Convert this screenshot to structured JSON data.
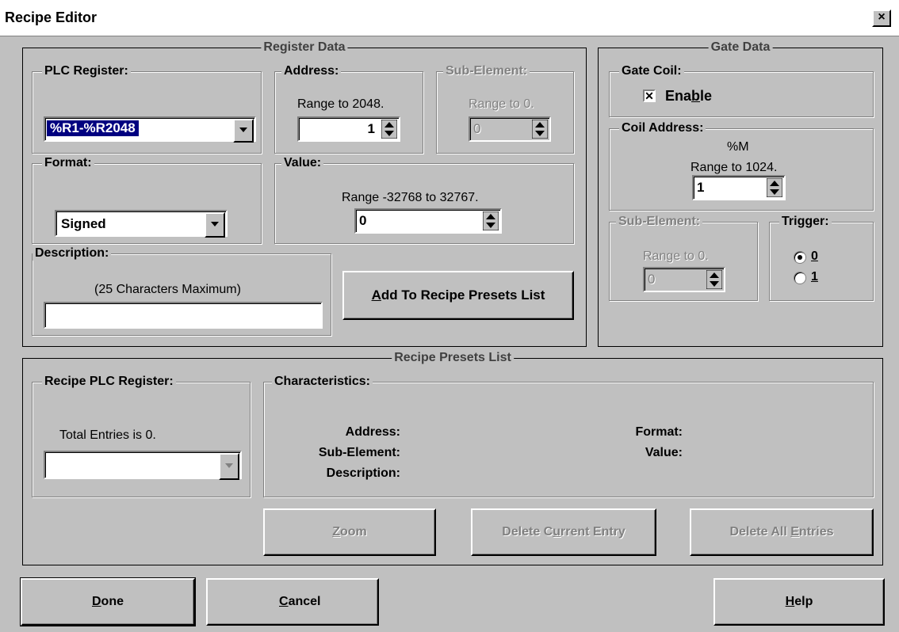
{
  "window": {
    "title": "Recipe Editor",
    "close_glyph": "×"
  },
  "register_data": {
    "title": "Register Data",
    "plc_register": {
      "label": "PLC Register:",
      "value": "%R1-%R2048"
    },
    "address": {
      "label": "Address:",
      "range": "Range to 2048.",
      "value": "1"
    },
    "sub_element": {
      "label": "Sub-Element:",
      "range": "Range to 0.",
      "value": "0"
    },
    "format": {
      "label": "Format:",
      "value": "Signed"
    },
    "value": {
      "label": "Value:",
      "range": "Range -32768 to 32767.",
      "value": "0"
    },
    "description": {
      "label": "Description:",
      "hint": "(25 Characters Maximum)",
      "value": ""
    },
    "add_button": {
      "accel": "A",
      "rest": "dd To Recipe Presets List"
    }
  },
  "gate_data": {
    "title": "Gate Data",
    "gate_coil": {
      "label": "Gate Coil:",
      "enable_pre": "Ena",
      "enable_accel": "b",
      "enable_post": "le",
      "checked": true
    },
    "coil_address": {
      "label": "Coil Address:",
      "prefix": "%M",
      "range": "Range to 1024.",
      "value": "1"
    },
    "sub_element": {
      "label": "Sub-Element:",
      "range": "Range to 0.",
      "value": "0"
    },
    "trigger": {
      "label": "Trigger:",
      "options": [
        "0",
        "1"
      ],
      "selected": "0"
    }
  },
  "recipe_presets": {
    "title": "Recipe Presets List",
    "recipe_plc_register": {
      "label": "Recipe PLC Register:",
      "total": "Total Entries is 0.",
      "value": ""
    },
    "characteristics": {
      "label": "Characteristics:",
      "address_label": "Address:",
      "sub_element_label": "Sub-Element:",
      "description_label": "Description:",
      "format_label": "Format:",
      "value_label": "Value:"
    },
    "zoom_button": {
      "accel": "Z",
      "rest": "oom"
    },
    "delete_current_button": {
      "pre": "Delete C",
      "accel": "u",
      "post": "rrent Entry"
    },
    "delete_all_button": {
      "pre": "Delete All ",
      "accel": "E",
      "post": "ntries"
    }
  },
  "footer": {
    "done_button": {
      "accel": "D",
      "rest": "one"
    },
    "cancel_button": {
      "accel": "C",
      "rest": "ancel"
    },
    "help_button": {
      "accel": "H",
      "rest": "elp"
    }
  },
  "icons": {
    "spinner": "spin-updown-icon",
    "dropdown": "dropdown-arrow-icon",
    "close": "close-icon"
  }
}
